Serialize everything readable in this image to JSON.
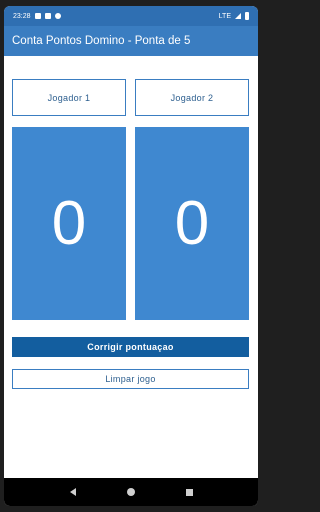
{
  "status_bar": {
    "time": "23:28",
    "network": "LTE"
  },
  "app_bar": {
    "title": "Conta Pontos Domino - Ponta de 5"
  },
  "players": [
    {
      "label": "Jogador 1"
    },
    {
      "label": "Jogador 2"
    }
  ],
  "scores": [
    {
      "value": "0"
    },
    {
      "value": "0"
    }
  ],
  "actions": {
    "correct_label": "Corrigir pontuaçao",
    "clear_label": "Limpar jogo"
  },
  "colors": {
    "app_bar": "#3a7dc1",
    "score_panel": "#3f88d0",
    "correct_button": "#135e9f"
  },
  "icons": {
    "nav": [
      "back-icon",
      "home-icon",
      "recent-apps-icon"
    ]
  }
}
